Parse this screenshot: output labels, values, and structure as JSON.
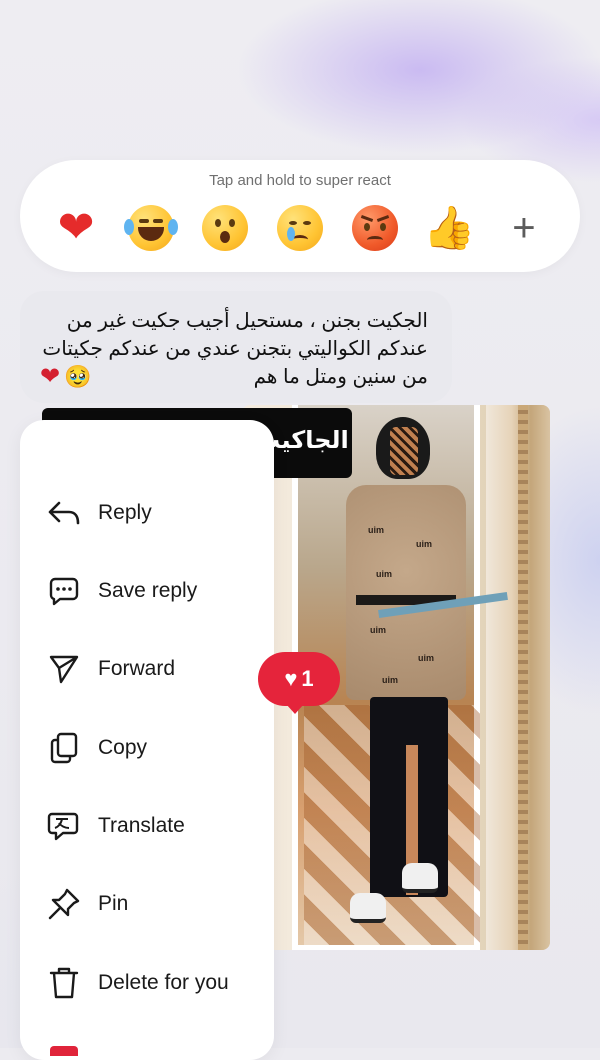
{
  "reaction_bar": {
    "hint": "Tap and hold to super react",
    "reactions": [
      {
        "icon": "red-heart-icon",
        "glyph": "❤"
      },
      {
        "icon": "laughing-tears-emoji-icon"
      },
      {
        "icon": "surprised-emoji-icon"
      },
      {
        "icon": "crying-emoji-icon"
      },
      {
        "icon": "angry-emoji-icon"
      },
      {
        "icon": "thumbs-up-emoji-icon",
        "glyph": "👍"
      }
    ],
    "more_label": "+"
  },
  "message": {
    "text": "الجكيت بجنن ، مستحيل أجيب جكيت غير من عندكم الكواليتي بتجنن عندي من عندكم جكيتات من سنين ومتل ما هم",
    "trailing_emojis": [
      "🥹",
      "❤"
    ]
  },
  "photo": {
    "caption": "الجاكيت متوفر في الموقع💞",
    "reaction_count": "1",
    "reaction_glyph": "♥",
    "jacket_print": "uim"
  },
  "menu": {
    "items": [
      {
        "label": "Reply",
        "icon": "reply-arrow-icon"
      },
      {
        "label": "Save reply",
        "icon": "save-reply-icon"
      },
      {
        "label": "Forward",
        "icon": "paper-plane-icon"
      },
      {
        "label": "Copy",
        "icon": "copy-icon"
      },
      {
        "label": "Translate",
        "icon": "translate-icon"
      },
      {
        "label": "Pin",
        "icon": "pin-icon"
      },
      {
        "label": "Delete for you",
        "icon": "trash-icon"
      }
    ]
  },
  "colors": {
    "heart_red": "#e5243b",
    "bubble_gray": "#e9e9ee",
    "accent_purple": "#c4b2f2"
  }
}
